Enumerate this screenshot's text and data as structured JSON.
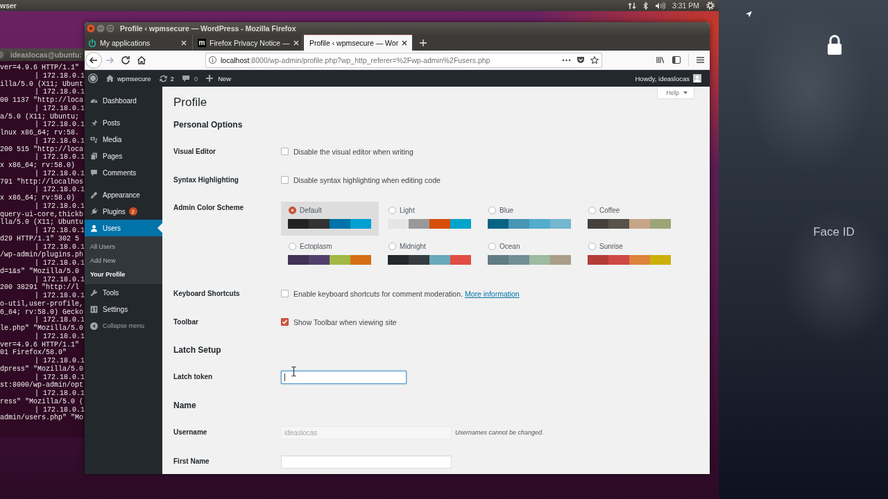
{
  "top_panel": {
    "app_name": "wser",
    "clock": "3:31 PM"
  },
  "terminal": {
    "title": "ideaslocas@ubuntu:",
    "lines": [
      {
        "kind": "log",
        "text": "ver=4.9.6 HTTP/1.1\""
      },
      {
        "kind": "ip",
        "text": "| 172.18.0.1"
      },
      {
        "kind": "log",
        "text": "illa/5.0 (X11; Ubunt"
      },
      {
        "kind": "ip",
        "text": "| 172.18.0.1"
      },
      {
        "kind": "log",
        "text": "00 1137 \"http://loca"
      },
      {
        "kind": "ip",
        "text": "| 172.18.0.1"
      },
      {
        "kind": "log",
        "text": "a/5.0 (X11; Ubuntu;"
      },
      {
        "kind": "ip",
        "text": "| 172.18.0.1"
      },
      {
        "kind": "log",
        "text": "lnux x86_64; rv:58."
      },
      {
        "kind": "ip",
        "text": "| 172.18.0.1"
      },
      {
        "kind": "log",
        "text": "200 515 \"http://loca"
      },
      {
        "kind": "ip",
        "text": "| 172.18.0.1"
      },
      {
        "kind": "log",
        "text": "x x86_64; rv:58.0)"
      },
      {
        "kind": "ip",
        "text": "| 172.18.0.1"
      },
      {
        "kind": "log",
        "text": "791 \"http://localhos"
      },
      {
        "kind": "ip",
        "text": "| 172.18.0.1"
      },
      {
        "kind": "log",
        "text": "x x86_64; rv:58.0)"
      },
      {
        "kind": "ip",
        "text": "| 172.18.0.1"
      },
      {
        "kind": "log",
        "text": "query-ui-core,thickb"
      },
      {
        "kind": "log",
        "text": "lla/5.0 (X11; Ubuntu"
      },
      {
        "kind": "ip",
        "text": "| 172.18.0.1"
      },
      {
        "kind": "log",
        "text": "d29 HTTP/1.1\" 302 5"
      },
      {
        "kind": "ip",
        "text": "| 172.18.0.1"
      },
      {
        "kind": "log",
        "text": "/wp-admin/plugins.ph"
      },
      {
        "kind": "ip",
        "text": "| 172.18.0.1"
      },
      {
        "kind": "log",
        "text": "d=1&s\" \"Mozilla/5.0"
      },
      {
        "kind": "ip",
        "text": "| 172.18.0.1"
      },
      {
        "kind": "log",
        "text": "200 38291 \"http://l"
      },
      {
        "kind": "ip",
        "text": "| 172.18.0.1"
      },
      {
        "kind": "log",
        "text": "o-util,user-profile,"
      },
      {
        "kind": "log",
        "text": "6_64; rv:58.0) Gecko"
      },
      {
        "kind": "ip",
        "text": "| 172.18.0.1"
      },
      {
        "kind": "log",
        "text": "le.php\" \"Mozilla/5.0"
      },
      {
        "kind": "ip",
        "text": "| 172.18.0.1"
      },
      {
        "kind": "log",
        "text": "ver=4.9.6 HTTP/1.1\""
      },
      {
        "kind": "log",
        "text": "01 Firefox/58.0\""
      },
      {
        "kind": "ip",
        "text": "| 172.18.0.1"
      },
      {
        "kind": "log",
        "text": "dpress\" \"Mozilla/5.0"
      },
      {
        "kind": "ip",
        "text": "| 172.18.0.1"
      },
      {
        "kind": "log",
        "text": "st:8000/wp-admin/opt"
      },
      {
        "kind": "ip",
        "text": "| 172.18.0.1"
      },
      {
        "kind": "log",
        "text": "ress\" \"Mozilla/5.0 ("
      },
      {
        "kind": "ip",
        "text": "| 172.18.0.1"
      },
      {
        "kind": "log",
        "text": "admin/users.php\" \"Mo"
      }
    ]
  },
  "browser": {
    "title": "Profile ‹ wpmsecure — WordPress - Mozilla Firefox",
    "tabs": [
      {
        "kind": "power",
        "label": "My applications",
        "selected": false
      },
      {
        "kind": "letter",
        "icon_text": "m",
        "label": "Firefox Privacy Notice —",
        "selected": false
      },
      {
        "kind": "plain",
        "label": "Profile ‹ wpmsecure — Wor",
        "selected": true
      }
    ],
    "url": {
      "host": "localhost",
      "rest": ":8000/wp-admin/profile.php?wp_http_referer=%2Fwp-admin%2Fusers.php"
    }
  },
  "wp": {
    "admin_bar": {
      "site": "wpmsecure",
      "updates": "2",
      "comments": "0",
      "new": "New",
      "greeting": "Howdy, ideaslocas"
    },
    "menu": {
      "groups": [
        {
          "items": [
            {
              "label": "Dashboard",
              "selected": false
            }
          ]
        },
        {
          "items": [
            {
              "label": "Posts",
              "selected": false
            },
            {
              "label": "Media",
              "selected": false
            },
            {
              "label": "Pages",
              "selected": false
            },
            {
              "label": "Comments",
              "selected": false
            }
          ]
        },
        {
          "items": [
            {
              "label": "Appearance",
              "selected": false
            },
            {
              "label": "Plugins",
              "badge": "2",
              "selected": false
            },
            {
              "label": "Users",
              "selected": true,
              "children": [
                {
                  "label": "All Users",
                  "selected": false
                },
                {
                  "label": "Add New",
                  "selected": false
                },
                {
                  "label": "Your Profile",
                  "selected": true
                }
              ]
            },
            {
              "label": "Tools",
              "selected": false
            },
            {
              "label": "Settings",
              "selected": false
            }
          ]
        }
      ],
      "collapse": "Collapse menu"
    },
    "help": "Help",
    "page_title": "Profile",
    "sections": [
      {
        "heading": "Personal Options",
        "rows": [
          {
            "kind": "checkbox",
            "label": "Visual Editor",
            "text": "Disable the visual editor when writing",
            "checked": false
          },
          {
            "kind": "checkbox",
            "label": "Syntax Highlighting",
            "text": "Disable syntax highlighting when editing code",
            "checked": false
          },
          {
            "kind": "schemes",
            "label": "Admin Color Scheme",
            "schemes": [
              {
                "name": "Default",
                "selected": true,
                "swatches": [
                  {
                    "color": "#222222"
                  },
                  {
                    "color": "#333333"
                  },
                  {
                    "color": "#0073aa"
                  },
                  {
                    "color": "#00a0d2"
                  }
                ]
              },
              {
                "name": "Light",
                "selected": false,
                "swatches": [
                  {
                    "color": "#e5e5e5"
                  },
                  {
                    "color": "#999999"
                  },
                  {
                    "color": "#d64e07"
                  },
                  {
                    "color": "#04a4cc"
                  }
                ]
              },
              {
                "name": "Blue",
                "selected": false,
                "swatches": [
                  {
                    "color": "#096484"
                  },
                  {
                    "color": "#4796b3"
                  },
                  {
                    "color": "#52accc"
                  },
                  {
                    "color": "#74b6ce"
                  }
                ]
              },
              {
                "name": "Coffee",
                "selected": false,
                "swatches": [
                  {
                    "color": "#46403c"
                  },
                  {
                    "color": "#59524c"
                  },
                  {
                    "color": "#c7a589"
                  },
                  {
                    "color": "#9ea476"
                  }
                ]
              },
              {
                "name": "Ectoplasm",
                "selected": false,
                "swatches": [
                  {
                    "color": "#413256"
                  },
                  {
                    "color": "#523f6d"
                  },
                  {
                    "color": "#a3b745"
                  },
                  {
                    "color": "#d46f15"
                  }
                ]
              },
              {
                "name": "Midnight",
                "selected": false,
                "swatches": [
                  {
                    "color": "#25282b"
                  },
                  {
                    "color": "#363b3f"
                  },
                  {
                    "color": "#69a8bb"
                  },
                  {
                    "color": "#e14d43"
                  }
                ]
              },
              {
                "name": "Ocean",
                "selected": false,
                "swatches": [
                  {
                    "color": "#627c83"
                  },
                  {
                    "color": "#738e96"
                  },
                  {
                    "color": "#9ebaa0"
                  },
                  {
                    "color": "#aa9d88"
                  }
                ]
              },
              {
                "name": "Sunrise",
                "selected": false,
                "swatches": [
                  {
                    "color": "#b43c38"
                  },
                  {
                    "color": "#cf4944"
                  },
                  {
                    "color": "#dd823b"
                  },
                  {
                    "color": "#ccaf0b"
                  }
                ]
              }
            ]
          },
          {
            "kind": "checkbox",
            "label": "Keyboard Shortcuts",
            "text": "Enable keyboard shortcuts for comment moderation.",
            "link": "More information",
            "checked": false
          },
          {
            "kind": "checkbox",
            "label": "Toolbar",
            "text": "Show Toolbar when viewing site",
            "checked": true
          }
        ]
      },
      {
        "heading": "Latch Setup",
        "rows": [
          {
            "kind": "token",
            "label": "Latch token",
            "focused": true,
            "disabled": false
          }
        ]
      },
      {
        "heading": "Name",
        "rows": [
          {
            "kind": "text",
            "label": "Username",
            "value": "ideaslocas",
            "note": "Usernames cannot be changed.",
            "focused": false,
            "disabled": true
          },
          {
            "kind": "text",
            "label": "First Name",
            "focused": false,
            "disabled": false
          }
        ]
      }
    ]
  },
  "phone": {
    "caption": "Face ID"
  }
}
